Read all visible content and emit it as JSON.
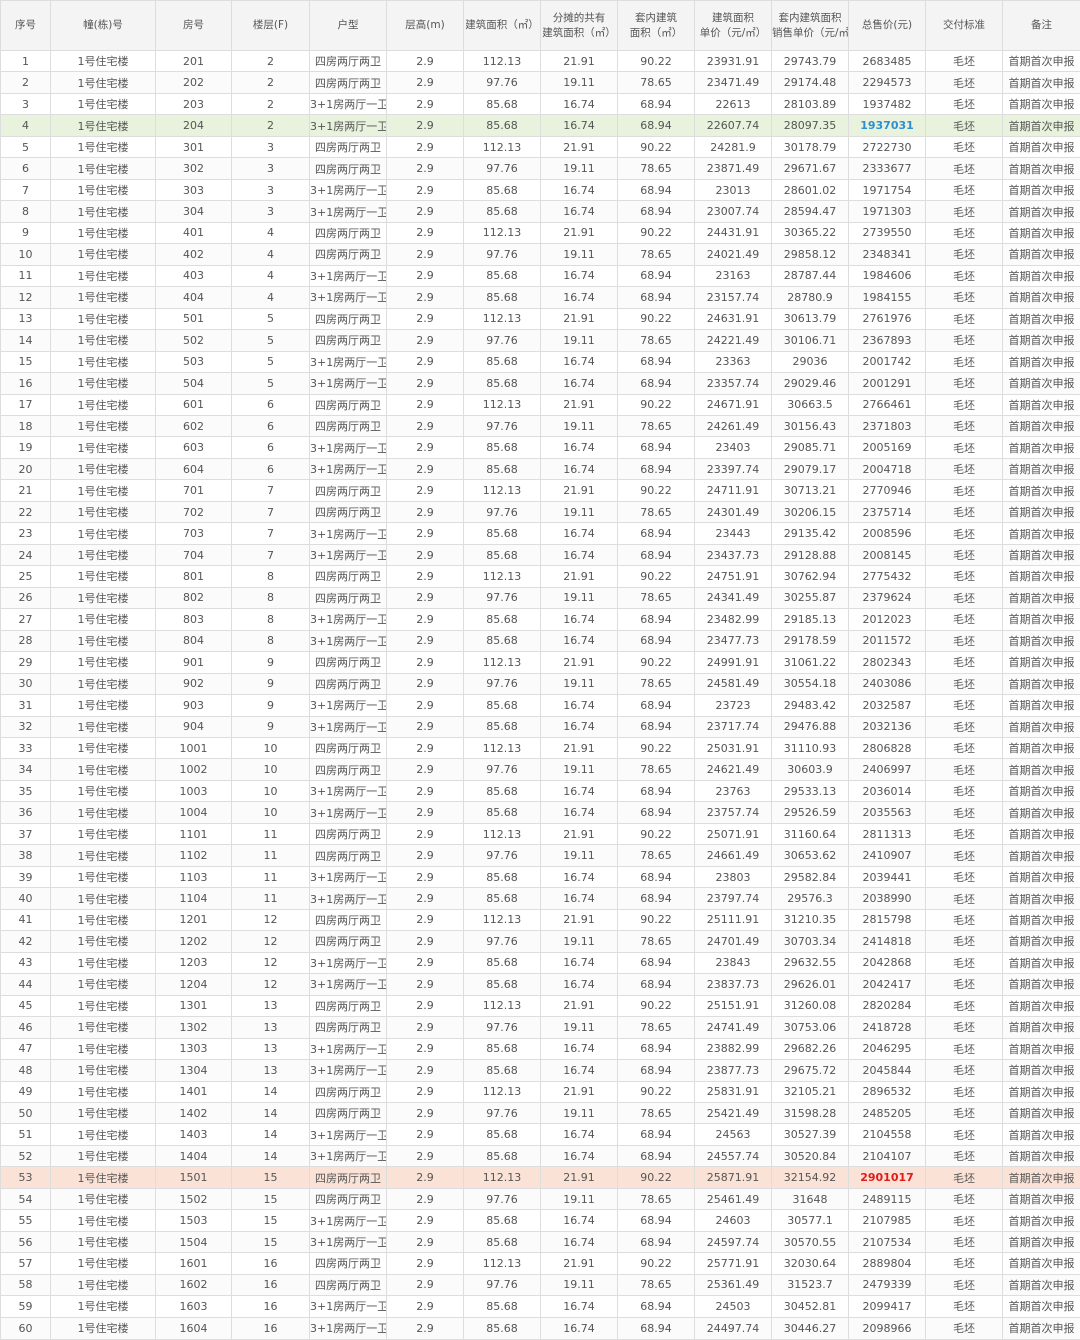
{
  "headers": [
    {
      "lines": [
        "序号"
      ]
    },
    {
      "lines": [
        "幢(栋)号"
      ]
    },
    {
      "lines": [
        "房号"
      ]
    },
    {
      "lines": [
        "楼层(F)"
      ]
    },
    {
      "lines": [
        "户型"
      ]
    },
    {
      "lines": [
        "层高(m)"
      ]
    },
    {
      "lines": [
        "建筑面积（㎡）"
      ]
    },
    {
      "lines": [
        "分摊的共有",
        "建筑面积（㎡）"
      ]
    },
    {
      "lines": [
        "套内建筑",
        "面积（㎡）"
      ]
    },
    {
      "lines": [
        "建筑面积",
        "单价（元/㎡）"
      ]
    },
    {
      "lines": [
        "套内建筑面积",
        "销售单价（元/㎡）"
      ]
    },
    {
      "lines": [
        "总售价(元)"
      ]
    },
    {
      "lines": [
        "交付标准"
      ]
    },
    {
      "lines": [
        "备注"
      ]
    }
  ],
  "rows": [
    [
      "1",
      "1号住宅楼",
      "201",
      "2",
      "四房两厅两卫",
      "2.9",
      "112.13",
      "21.91",
      "90.22",
      "23931.91",
      "29743.79",
      "2683485",
      "毛坯",
      "首期首次申报"
    ],
    [
      "2",
      "1号住宅楼",
      "202",
      "2",
      "四房两厅两卫",
      "2.9",
      "97.76",
      "19.11",
      "78.65",
      "23471.49",
      "29174.48",
      "2294573",
      "毛坯",
      "首期首次申报"
    ],
    [
      "3",
      "1号住宅楼",
      "203",
      "2",
      "3+1房两厅一卫",
      "2.9",
      "85.68",
      "16.74",
      "68.94",
      "22613",
      "28103.89",
      "1937482",
      "毛坯",
      "首期首次申报"
    ],
    [
      "4",
      "1号住宅楼",
      "204",
      "2",
      "3+1房两厅一卫",
      "2.9",
      "85.68",
      "16.74",
      "68.94",
      "22607.74",
      "28097.35",
      "1937031",
      "毛坯",
      "首期首次申报"
    ],
    [
      "5",
      "1号住宅楼",
      "301",
      "3",
      "四房两厅两卫",
      "2.9",
      "112.13",
      "21.91",
      "90.22",
      "24281.9",
      "30178.79",
      "2722730",
      "毛坯",
      "首期首次申报"
    ],
    [
      "6",
      "1号住宅楼",
      "302",
      "3",
      "四房两厅两卫",
      "2.9",
      "97.76",
      "19.11",
      "78.65",
      "23871.49",
      "29671.67",
      "2333677",
      "毛坯",
      "首期首次申报"
    ],
    [
      "7",
      "1号住宅楼",
      "303",
      "3",
      "3+1房两厅一卫",
      "2.9",
      "85.68",
      "16.74",
      "68.94",
      "23013",
      "28601.02",
      "1971754",
      "毛坯",
      "首期首次申报"
    ],
    [
      "8",
      "1号住宅楼",
      "304",
      "3",
      "3+1房两厅一卫",
      "2.9",
      "85.68",
      "16.74",
      "68.94",
      "23007.74",
      "28594.47",
      "1971303",
      "毛坯",
      "首期首次申报"
    ],
    [
      "9",
      "1号住宅楼",
      "401",
      "4",
      "四房两厅两卫",
      "2.9",
      "112.13",
      "21.91",
      "90.22",
      "24431.91",
      "30365.22",
      "2739550",
      "毛坯",
      "首期首次申报"
    ],
    [
      "10",
      "1号住宅楼",
      "402",
      "4",
      "四房两厅两卫",
      "2.9",
      "97.76",
      "19.11",
      "78.65",
      "24021.49",
      "29858.12",
      "2348341",
      "毛坯",
      "首期首次申报"
    ],
    [
      "11",
      "1号住宅楼",
      "403",
      "4",
      "3+1房两厅一卫",
      "2.9",
      "85.68",
      "16.74",
      "68.94",
      "23163",
      "28787.44",
      "1984606",
      "毛坯",
      "首期首次申报"
    ],
    [
      "12",
      "1号住宅楼",
      "404",
      "4",
      "3+1房两厅一卫",
      "2.9",
      "85.68",
      "16.74",
      "68.94",
      "23157.74",
      "28780.9",
      "1984155",
      "毛坯",
      "首期首次申报"
    ],
    [
      "13",
      "1号住宅楼",
      "501",
      "5",
      "四房两厅两卫",
      "2.9",
      "112.13",
      "21.91",
      "90.22",
      "24631.91",
      "30613.79",
      "2761976",
      "毛坯",
      "首期首次申报"
    ],
    [
      "14",
      "1号住宅楼",
      "502",
      "5",
      "四房两厅两卫",
      "2.9",
      "97.76",
      "19.11",
      "78.65",
      "24221.49",
      "30106.71",
      "2367893",
      "毛坯",
      "首期首次申报"
    ],
    [
      "15",
      "1号住宅楼",
      "503",
      "5",
      "3+1房两厅一卫",
      "2.9",
      "85.68",
      "16.74",
      "68.94",
      "23363",
      "29036",
      "2001742",
      "毛坯",
      "首期首次申报"
    ],
    [
      "16",
      "1号住宅楼",
      "504",
      "5",
      "3+1房两厅一卫",
      "2.9",
      "85.68",
      "16.74",
      "68.94",
      "23357.74",
      "29029.46",
      "2001291",
      "毛坯",
      "首期首次申报"
    ],
    [
      "17",
      "1号住宅楼",
      "601",
      "6",
      "四房两厅两卫",
      "2.9",
      "112.13",
      "21.91",
      "90.22",
      "24671.91",
      "30663.5",
      "2766461",
      "毛坯",
      "首期首次申报"
    ],
    [
      "18",
      "1号住宅楼",
      "602",
      "6",
      "四房两厅两卫",
      "2.9",
      "97.76",
      "19.11",
      "78.65",
      "24261.49",
      "30156.43",
      "2371803",
      "毛坯",
      "首期首次申报"
    ],
    [
      "19",
      "1号住宅楼",
      "603",
      "6",
      "3+1房两厅一卫",
      "2.9",
      "85.68",
      "16.74",
      "68.94",
      "23403",
      "29085.71",
      "2005169",
      "毛坯",
      "首期首次申报"
    ],
    [
      "20",
      "1号住宅楼",
      "604",
      "6",
      "3+1房两厅一卫",
      "2.9",
      "85.68",
      "16.74",
      "68.94",
      "23397.74",
      "29079.17",
      "2004718",
      "毛坯",
      "首期首次申报"
    ],
    [
      "21",
      "1号住宅楼",
      "701",
      "7",
      "四房两厅两卫",
      "2.9",
      "112.13",
      "21.91",
      "90.22",
      "24711.91",
      "30713.21",
      "2770946",
      "毛坯",
      "首期首次申报"
    ],
    [
      "22",
      "1号住宅楼",
      "702",
      "7",
      "四房两厅两卫",
      "2.9",
      "97.76",
      "19.11",
      "78.65",
      "24301.49",
      "30206.15",
      "2375714",
      "毛坯",
      "首期首次申报"
    ],
    [
      "23",
      "1号住宅楼",
      "703",
      "7",
      "3+1房两厅一卫",
      "2.9",
      "85.68",
      "16.74",
      "68.94",
      "23443",
      "29135.42",
      "2008596",
      "毛坯",
      "首期首次申报"
    ],
    [
      "24",
      "1号住宅楼",
      "704",
      "7",
      "3+1房两厅一卫",
      "2.9",
      "85.68",
      "16.74",
      "68.94",
      "23437.73",
      "29128.88",
      "2008145",
      "毛坯",
      "首期首次申报"
    ],
    [
      "25",
      "1号住宅楼",
      "801",
      "8",
      "四房两厅两卫",
      "2.9",
      "112.13",
      "21.91",
      "90.22",
      "24751.91",
      "30762.94",
      "2775432",
      "毛坯",
      "首期首次申报"
    ],
    [
      "26",
      "1号住宅楼",
      "802",
      "8",
      "四房两厅两卫",
      "2.9",
      "97.76",
      "19.11",
      "78.65",
      "24341.49",
      "30255.87",
      "2379624",
      "毛坯",
      "首期首次申报"
    ],
    [
      "27",
      "1号住宅楼",
      "803",
      "8",
      "3+1房两厅一卫",
      "2.9",
      "85.68",
      "16.74",
      "68.94",
      "23482.99",
      "29185.13",
      "2012023",
      "毛坯",
      "首期首次申报"
    ],
    [
      "28",
      "1号住宅楼",
      "804",
      "8",
      "3+1房两厅一卫",
      "2.9",
      "85.68",
      "16.74",
      "68.94",
      "23477.73",
      "29178.59",
      "2011572",
      "毛坯",
      "首期首次申报"
    ],
    [
      "29",
      "1号住宅楼",
      "901",
      "9",
      "四房两厅两卫",
      "2.9",
      "112.13",
      "21.91",
      "90.22",
      "24991.91",
      "31061.22",
      "2802343",
      "毛坯",
      "首期首次申报"
    ],
    [
      "30",
      "1号住宅楼",
      "902",
      "9",
      "四房两厅两卫",
      "2.9",
      "97.76",
      "19.11",
      "78.65",
      "24581.49",
      "30554.18",
      "2403086",
      "毛坯",
      "首期首次申报"
    ],
    [
      "31",
      "1号住宅楼",
      "903",
      "9",
      "3+1房两厅一卫",
      "2.9",
      "85.68",
      "16.74",
      "68.94",
      "23723",
      "29483.42",
      "2032587",
      "毛坯",
      "首期首次申报"
    ],
    [
      "32",
      "1号住宅楼",
      "904",
      "9",
      "3+1房两厅一卫",
      "2.9",
      "85.68",
      "16.74",
      "68.94",
      "23717.74",
      "29476.88",
      "2032136",
      "毛坯",
      "首期首次申报"
    ],
    [
      "33",
      "1号住宅楼",
      "1001",
      "10",
      "四房两厅两卫",
      "2.9",
      "112.13",
      "21.91",
      "90.22",
      "25031.91",
      "31110.93",
      "2806828",
      "毛坯",
      "首期首次申报"
    ],
    [
      "34",
      "1号住宅楼",
      "1002",
      "10",
      "四房两厅两卫",
      "2.9",
      "97.76",
      "19.11",
      "78.65",
      "24621.49",
      "30603.9",
      "2406997",
      "毛坯",
      "首期首次申报"
    ],
    [
      "35",
      "1号住宅楼",
      "1003",
      "10",
      "3+1房两厅一卫",
      "2.9",
      "85.68",
      "16.74",
      "68.94",
      "23763",
      "29533.13",
      "2036014",
      "毛坯",
      "首期首次申报"
    ],
    [
      "36",
      "1号住宅楼",
      "1004",
      "10",
      "3+1房两厅一卫",
      "2.9",
      "85.68",
      "16.74",
      "68.94",
      "23757.74",
      "29526.59",
      "2035563",
      "毛坯",
      "首期首次申报"
    ],
    [
      "37",
      "1号住宅楼",
      "1101",
      "11",
      "四房两厅两卫",
      "2.9",
      "112.13",
      "21.91",
      "90.22",
      "25071.91",
      "31160.64",
      "2811313",
      "毛坯",
      "首期首次申报"
    ],
    [
      "38",
      "1号住宅楼",
      "1102",
      "11",
      "四房两厅两卫",
      "2.9",
      "97.76",
      "19.11",
      "78.65",
      "24661.49",
      "30653.62",
      "2410907",
      "毛坯",
      "首期首次申报"
    ],
    [
      "39",
      "1号住宅楼",
      "1103",
      "11",
      "3+1房两厅一卫",
      "2.9",
      "85.68",
      "16.74",
      "68.94",
      "23803",
      "29582.84",
      "2039441",
      "毛坯",
      "首期首次申报"
    ],
    [
      "40",
      "1号住宅楼",
      "1104",
      "11",
      "3+1房两厅一卫",
      "2.9",
      "85.68",
      "16.74",
      "68.94",
      "23797.74",
      "29576.3",
      "2038990",
      "毛坯",
      "首期首次申报"
    ],
    [
      "41",
      "1号住宅楼",
      "1201",
      "12",
      "四房两厅两卫",
      "2.9",
      "112.13",
      "21.91",
      "90.22",
      "25111.91",
      "31210.35",
      "2815798",
      "毛坯",
      "首期首次申报"
    ],
    [
      "42",
      "1号住宅楼",
      "1202",
      "12",
      "四房两厅两卫",
      "2.9",
      "97.76",
      "19.11",
      "78.65",
      "24701.49",
      "30703.34",
      "2414818",
      "毛坯",
      "首期首次申报"
    ],
    [
      "43",
      "1号住宅楼",
      "1203",
      "12",
      "3+1房两厅一卫",
      "2.9",
      "85.68",
      "16.74",
      "68.94",
      "23843",
      "29632.55",
      "2042868",
      "毛坯",
      "首期首次申报"
    ],
    [
      "44",
      "1号住宅楼",
      "1204",
      "12",
      "3+1房两厅一卫",
      "2.9",
      "85.68",
      "16.74",
      "68.94",
      "23837.73",
      "29626.01",
      "2042417",
      "毛坯",
      "首期首次申报"
    ],
    [
      "45",
      "1号住宅楼",
      "1301",
      "13",
      "四房两厅两卫",
      "2.9",
      "112.13",
      "21.91",
      "90.22",
      "25151.91",
      "31260.08",
      "2820284",
      "毛坯",
      "首期首次申报"
    ],
    [
      "46",
      "1号住宅楼",
      "1302",
      "13",
      "四房两厅两卫",
      "2.9",
      "97.76",
      "19.11",
      "78.65",
      "24741.49",
      "30753.06",
      "2418728",
      "毛坯",
      "首期首次申报"
    ],
    [
      "47",
      "1号住宅楼",
      "1303",
      "13",
      "3+1房两厅一卫",
      "2.9",
      "85.68",
      "16.74",
      "68.94",
      "23882.99",
      "29682.26",
      "2046295",
      "毛坯",
      "首期首次申报"
    ],
    [
      "48",
      "1号住宅楼",
      "1304",
      "13",
      "3+1房两厅一卫",
      "2.9",
      "85.68",
      "16.74",
      "68.94",
      "23877.73",
      "29675.72",
      "2045844",
      "毛坯",
      "首期首次申报"
    ],
    [
      "49",
      "1号住宅楼",
      "1401",
      "14",
      "四房两厅两卫",
      "2.9",
      "112.13",
      "21.91",
      "90.22",
      "25831.91",
      "32105.21",
      "2896532",
      "毛坯",
      "首期首次申报"
    ],
    [
      "50",
      "1号住宅楼",
      "1402",
      "14",
      "四房两厅两卫",
      "2.9",
      "97.76",
      "19.11",
      "78.65",
      "25421.49",
      "31598.28",
      "2485205",
      "毛坯",
      "首期首次申报"
    ],
    [
      "51",
      "1号住宅楼",
      "1403",
      "14",
      "3+1房两厅一卫",
      "2.9",
      "85.68",
      "16.74",
      "68.94",
      "24563",
      "30527.39",
      "2104558",
      "毛坯",
      "首期首次申报"
    ],
    [
      "52",
      "1号住宅楼",
      "1404",
      "14",
      "3+1房两厅一卫",
      "2.9",
      "85.68",
      "16.74",
      "68.94",
      "24557.74",
      "30520.84",
      "2104107",
      "毛坯",
      "首期首次申报"
    ],
    [
      "53",
      "1号住宅楼",
      "1501",
      "15",
      "四房两厅两卫",
      "2.9",
      "112.13",
      "21.91",
      "90.22",
      "25871.91",
      "32154.92",
      "2901017",
      "毛坯",
      "首期首次申报"
    ],
    [
      "54",
      "1号住宅楼",
      "1502",
      "15",
      "四房两厅两卫",
      "2.9",
      "97.76",
      "19.11",
      "78.65",
      "25461.49",
      "31648",
      "2489115",
      "毛坯",
      "首期首次申报"
    ],
    [
      "55",
      "1号住宅楼",
      "1503",
      "15",
      "3+1房两厅一卫",
      "2.9",
      "85.68",
      "16.74",
      "68.94",
      "24603",
      "30577.1",
      "2107985",
      "毛坯",
      "首期首次申报"
    ],
    [
      "56",
      "1号住宅楼",
      "1504",
      "15",
      "3+1房两厅一卫",
      "2.9",
      "85.68",
      "16.74",
      "68.94",
      "24597.74",
      "30570.55",
      "2107534",
      "毛坯",
      "首期首次申报"
    ],
    [
      "57",
      "1号住宅楼",
      "1601",
      "16",
      "四房两厅两卫",
      "2.9",
      "112.13",
      "21.91",
      "90.22",
      "25771.91",
      "32030.64",
      "2889804",
      "毛坯",
      "首期首次申报"
    ],
    [
      "58",
      "1号住宅楼",
      "1602",
      "16",
      "四房两厅两卫",
      "2.9",
      "97.76",
      "19.11",
      "78.65",
      "25361.49",
      "31523.7",
      "2479339",
      "毛坯",
      "首期首次申报"
    ],
    [
      "59",
      "1号住宅楼",
      "1603",
      "16",
      "3+1房两厅一卫",
      "2.9",
      "85.68",
      "16.74",
      "68.94",
      "24503",
      "30452.81",
      "2099417",
      "毛坯",
      "首期首次申报"
    ],
    [
      "60",
      "1号住宅楼",
      "1604",
      "16",
      "3+1房两厅一卫",
      "2.9",
      "85.68",
      "16.74",
      "68.94",
      "24497.74",
      "30446.27",
      "2098966",
      "毛坯",
      "首期首次申报"
    ]
  ],
  "highlights": {
    "lowest_price": {
      "row_index": 3,
      "row_color": "#e8f2dc",
      "price_color": "#2e8fd0"
    },
    "highest_price": {
      "row_index": 52,
      "row_color": "#fbe2d6",
      "price_color": "#e01b1b"
    }
  }
}
